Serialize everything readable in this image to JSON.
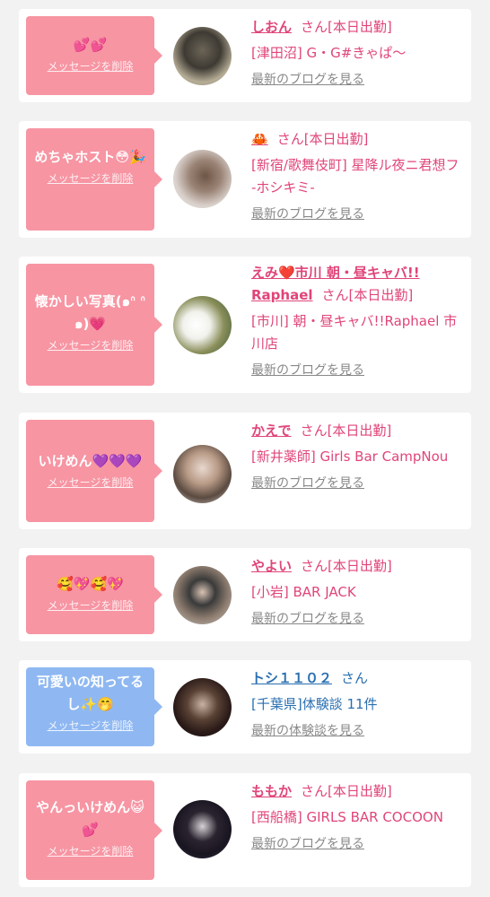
{
  "colors": {
    "pink_bubble": "#f795a3",
    "blue_bubble": "#8fb8f2",
    "pink_text": "#e0457a",
    "blue_text": "#2a6fb0",
    "link_gray": "#888888"
  },
  "items": [
    {
      "message": "💕💕",
      "delete": "メッセージを削除",
      "name": "しおん",
      "san": "さん[本日出勤]",
      "shop": "[津田沼] G・G#きゃぱ〜",
      "link": "最新のブログを見る"
    },
    {
      "message": "めちゃホスト😳🎉",
      "delete": "メッセージを削除",
      "name": "🦀",
      "san": "さん[本日出勤]",
      "shop": "[新宿/歌舞伎町] 星降ル夜ニ君想フ -ホシキミ-",
      "link": "最新のブログを見る"
    },
    {
      "message": "懐かしい写真(๑ᐢ ᐢ๑)💗",
      "delete": "メッセージを削除",
      "name": "えみ❤️市川 朝・昼キャバ!! Raphael",
      "san": "さん[本日出勤]",
      "shop": "[市川] 朝・昼キャバ!!Raphael 市川店",
      "link": "最新のブログを見る"
    },
    {
      "message": "いけめん💜💜💜",
      "delete": "メッセージを削除",
      "name": "かえで",
      "san": "さん[本日出勤]",
      "shop": "[新井薬師] Girls Bar CampNou",
      "link": "最新のブログを見る"
    },
    {
      "message": "🥰💖🥰💖",
      "delete": "メッセージを削除",
      "name": "やよい",
      "san": "さん[本日出勤]",
      "shop": "[小岩] BAR JACK",
      "link": "最新のブログを見る"
    },
    {
      "message": "可愛いの知ってるし✨🤭",
      "delete": "メッセージを削除",
      "name": "トシ１１０２",
      "san": "さん",
      "shop": "[千葉県]体験談 11件",
      "link": "最新の体験談を見る"
    },
    {
      "message": "やんっいけめん😺💕",
      "delete": "メッセージを削除",
      "name": "ももか",
      "san": "さん[本日出勤]",
      "shop": "[西船橋] GIRLS BAR COCOON",
      "link": "最新のブログを見る"
    }
  ]
}
